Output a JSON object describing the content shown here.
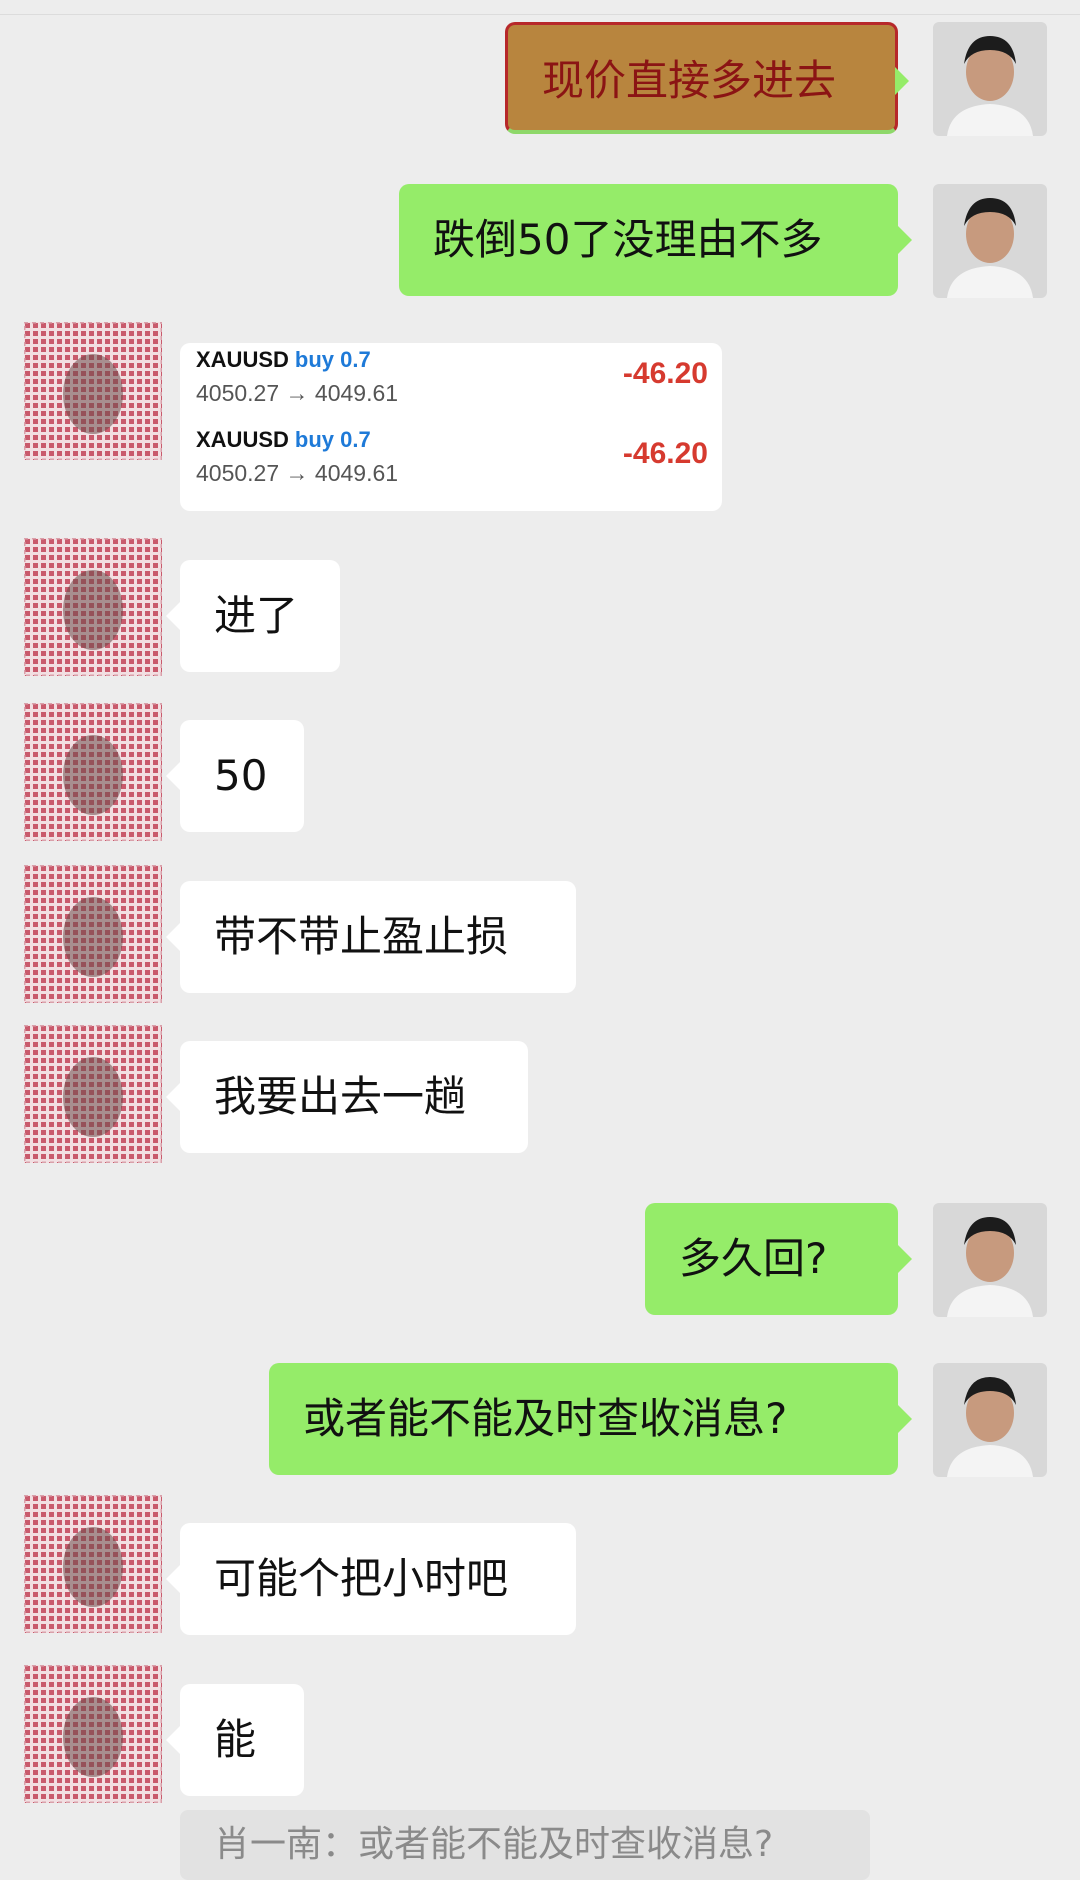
{
  "messages": [
    {
      "side": "right",
      "text": "现价直接多进去"
    },
    {
      "side": "right",
      "text": "跌倒50了没理由不多"
    },
    {
      "side": "left",
      "type": "trade_card"
    },
    {
      "side": "left",
      "text": "进了"
    },
    {
      "side": "left",
      "text": "50"
    },
    {
      "side": "left",
      "text": "带不带止盈止损"
    },
    {
      "side": "left",
      "text": "我要出去一趟"
    },
    {
      "side": "right",
      "text": "多久回?"
    },
    {
      "side": "right",
      "text": "或者能不能及时查收消息?"
    },
    {
      "side": "left",
      "text": "可能个把小时吧"
    },
    {
      "side": "left",
      "text": "能"
    }
  ],
  "trade_card": {
    "rows": [
      {
        "symbol": "XAUUSD",
        "direction": "buy 0.7",
        "prices": "4050.27 → 4049.61",
        "pnl": "-46.20"
      },
      {
        "symbol": "XAUUSD",
        "direction": "buy 0.7",
        "prices": "4050.27 → 4049.61",
        "pnl": "-46.20"
      }
    ]
  },
  "quote": {
    "text": "肖一南：或者能不能及时查收消息?"
  },
  "colors": {
    "background": "#ededed",
    "mine_bubble": "#95ec69",
    "theirs_bubble": "#ffffff",
    "pnl_negative": "#d63a2f",
    "buy_label": "#1e7ad8"
  },
  "icons": {
    "right_avatar": "man-portrait-avatar",
    "left_avatar": "pixelated-avatar"
  }
}
